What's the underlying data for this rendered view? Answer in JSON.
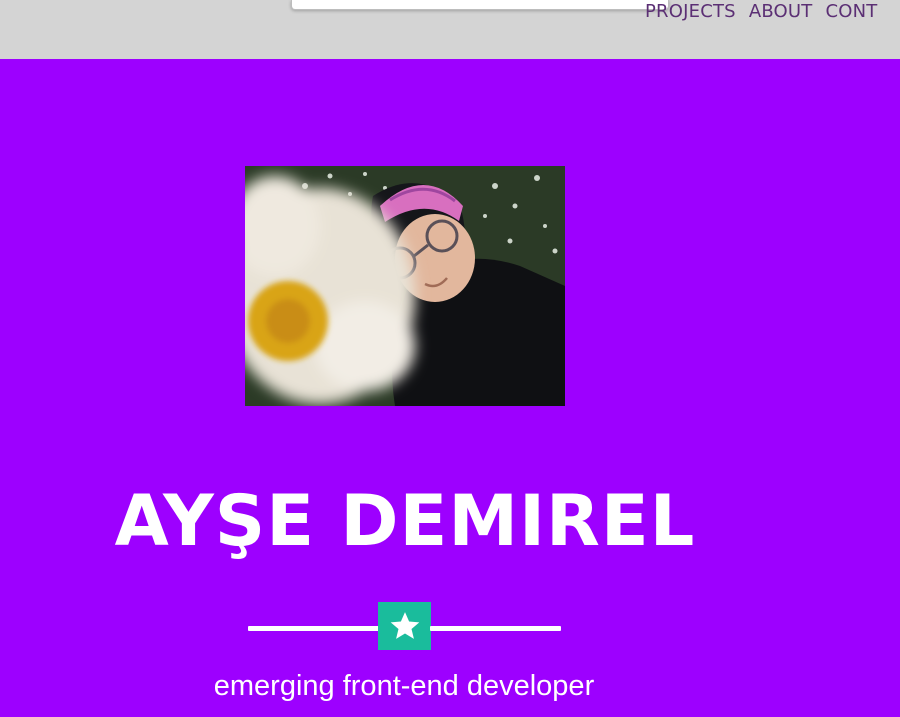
{
  "nav": {
    "items": [
      "PROJECTS",
      "ABOUT",
      "CONT"
    ]
  },
  "hero": {
    "name": "AYŞE DEMIREL",
    "tagline": "emerging front-end developer",
    "badge_icon": "star-icon"
  },
  "colors": {
    "hero_background": "#9d00ff",
    "topbar_background": "#d4d4d4",
    "nav_text": "#5b2f74",
    "badge": "#1abc9c",
    "text": "#ffffff"
  }
}
